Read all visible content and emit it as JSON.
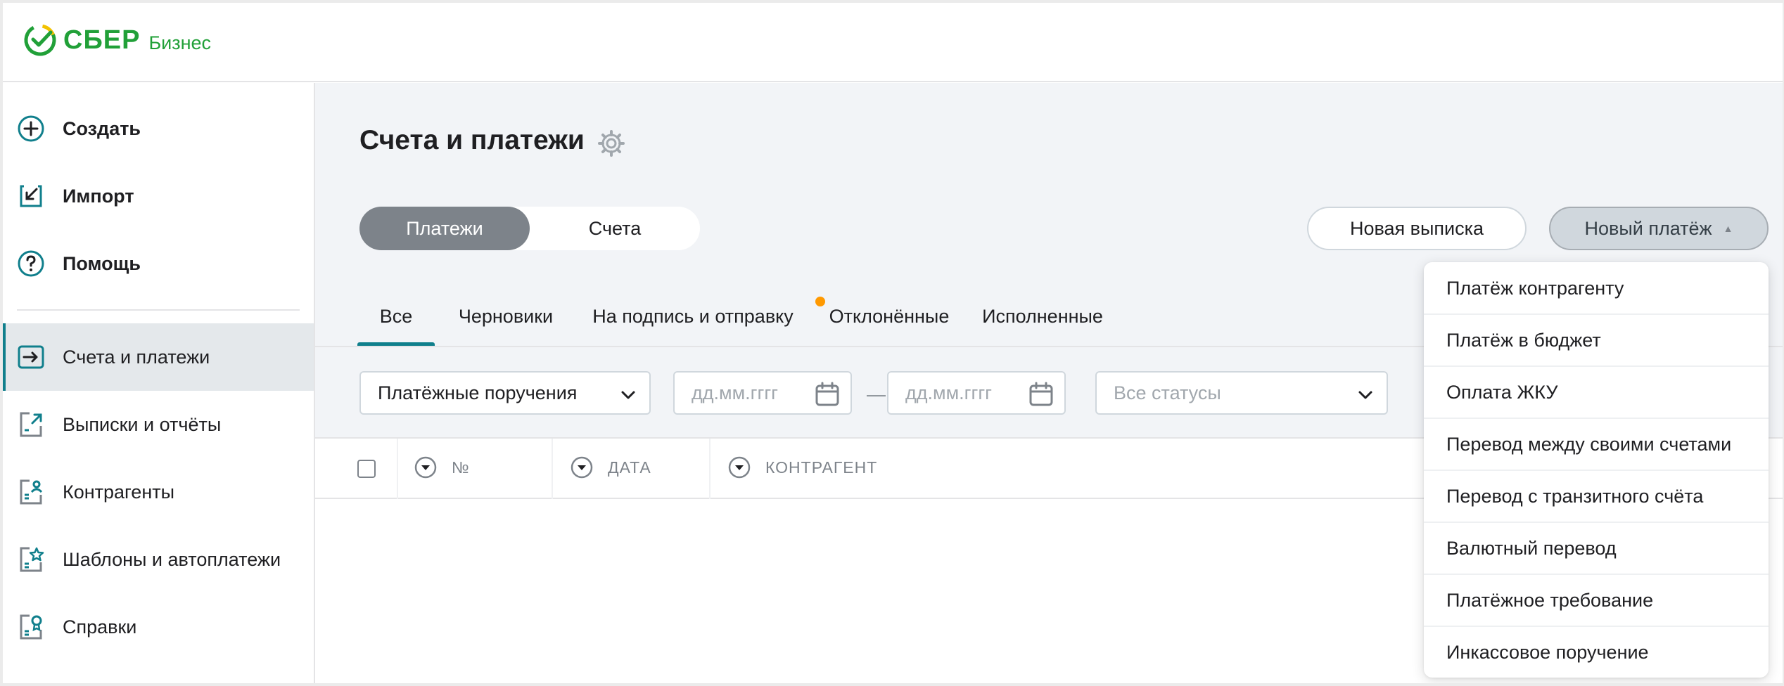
{
  "brand": {
    "name": "СБЕР",
    "suffix": "Бизнес",
    "color": "#21a038"
  },
  "sidebar": {
    "actions": [
      {
        "label": "Создать",
        "icon": "plus-circle-icon"
      },
      {
        "label": "Импорт",
        "icon": "import-icon"
      },
      {
        "label": "Помощь",
        "icon": "help-icon"
      }
    ],
    "items": [
      {
        "label": "Счета и платежи",
        "icon": "accounts-icon",
        "active": true
      },
      {
        "label": "Выписки и отчёты",
        "icon": "statements-icon"
      },
      {
        "label": "Контрагенты",
        "icon": "counterparties-icon"
      },
      {
        "label": "Шаблоны и автоплатежи",
        "icon": "templates-icon"
      },
      {
        "label": "Справки",
        "icon": "certificates-icon"
      }
    ]
  },
  "main": {
    "title": "Счета и платежи",
    "segments": [
      "Платежи",
      "Счета"
    ],
    "active_segment": "Платежи",
    "buttons": {
      "new_statement": "Новая выписка",
      "new_payment": "Новый платёж"
    },
    "tabs": [
      "Все",
      "Черновики",
      "На подпись и отправку",
      "Отклонённые",
      "Исполненные"
    ],
    "active_tab": "Все",
    "filters": {
      "doc_type": "Платёжные поручения",
      "date_from_placeholder": "дд.мм.гггг",
      "date_to_placeholder": "дд.мм.гггг",
      "date_separator": "—",
      "status_placeholder": "Все статусы"
    },
    "table": {
      "columns": [
        "№",
        "ДАТА",
        "КОНТРАГЕНТ"
      ]
    }
  },
  "dropdown": {
    "items": [
      "Платёж контрагенту",
      "Платёж в бюджет",
      "Оплата ЖКУ",
      "Перевод между своими счетами",
      "Перевод с транзитного счёта",
      "Валютный перевод",
      "Платёжное требование",
      "Инкассовое поручение"
    ]
  },
  "colors": {
    "accent": "#107f8c",
    "notification_dot": "#ff9900"
  }
}
